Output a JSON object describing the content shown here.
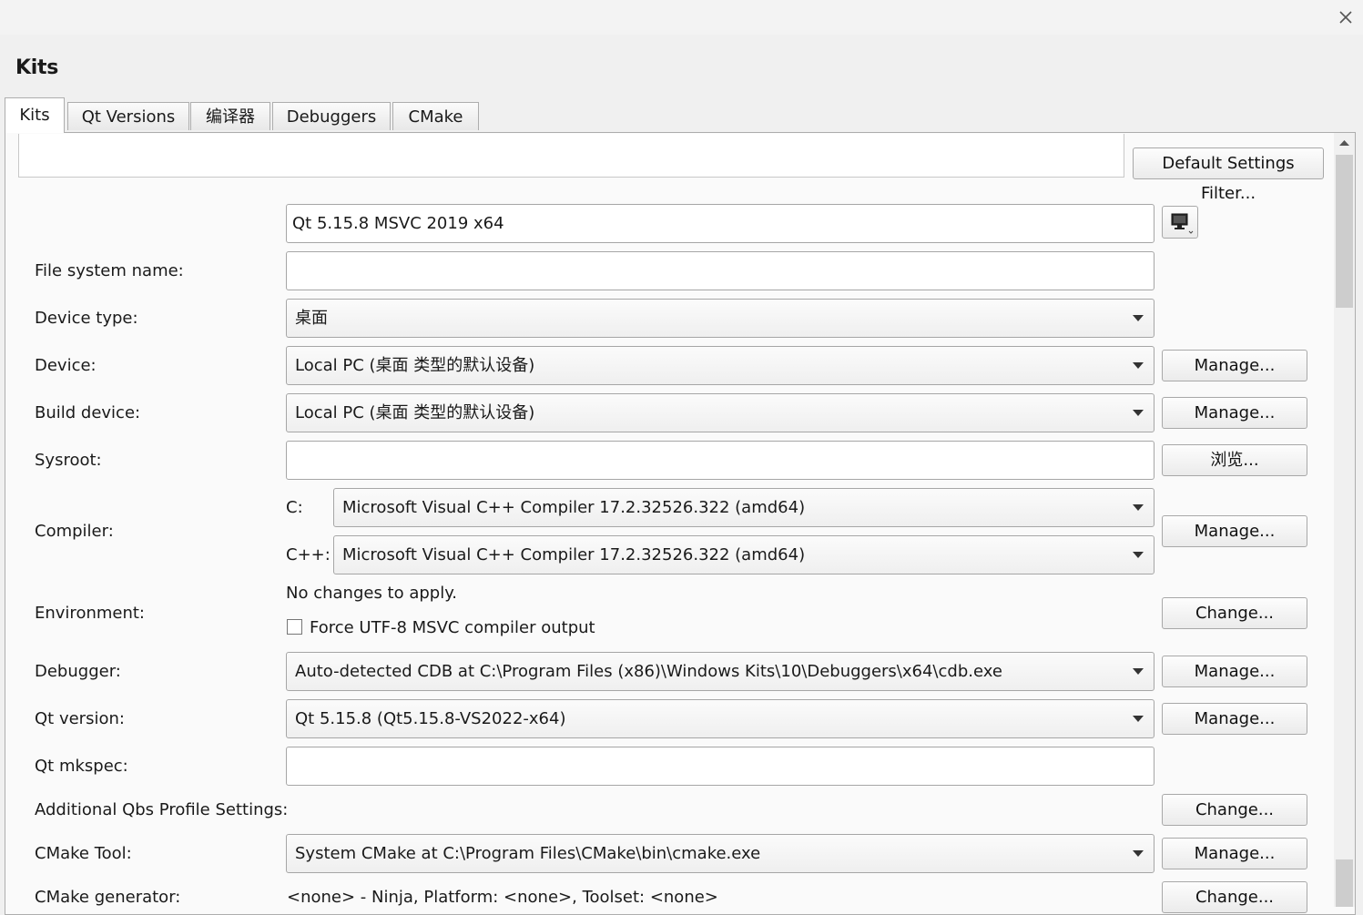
{
  "heading": "Kits",
  "tabs": [
    {
      "label": "Kits",
      "active": true
    },
    {
      "label": "Qt Versions",
      "active": false
    },
    {
      "label": "编译器",
      "active": false
    },
    {
      "label": "Debuggers",
      "active": false
    },
    {
      "label": "CMake",
      "active": false
    }
  ],
  "filter_button": "Default Settings Filter...",
  "kit_name": "Qt 5.15.8 MSVC 2019 x64",
  "icons": {
    "close": "close-icon",
    "device": "monitor-icon",
    "scroll_up": "scroll-up-arrow-icon"
  },
  "rows": {
    "fs_name": {
      "label": "File system name:",
      "value": ""
    },
    "device_type": {
      "label": "Device type:",
      "value": "桌面"
    },
    "device": {
      "label": "Device:",
      "value": "Local PC (桌面 类型的默认设备)",
      "button": "Manage..."
    },
    "build_device": {
      "label": "Build device:",
      "value": "Local PC (桌面 类型的默认设备)",
      "button": "Manage..."
    },
    "sysroot": {
      "label": "Sysroot:",
      "value": "",
      "button": "浏览..."
    },
    "compiler": {
      "label": "Compiler:",
      "c_label": "C:",
      "c_value": "Microsoft Visual C++ Compiler 17.2.32526.322 (amd64)",
      "cpp_label": "C++:",
      "cpp_value": "Microsoft Visual C++ Compiler 17.2.32526.322 (amd64)",
      "button": "Manage..."
    },
    "environment": {
      "label": "Environment:",
      "status": "No changes to apply.",
      "checkbox_label": "Force UTF-8 MSVC compiler output",
      "checkbox_checked": false,
      "button": "Change..."
    },
    "debugger": {
      "label": "Debugger:",
      "value": "Auto-detected CDB at C:\\Program Files (x86)\\Windows Kits\\10\\Debuggers\\x64\\cdb.exe",
      "button": "Manage..."
    },
    "qt_version": {
      "label": "Qt version:",
      "value": "Qt 5.15.8 (Qt5.15.8-VS2022-x64)",
      "button": "Manage..."
    },
    "qt_mkspec": {
      "label": "Qt mkspec:",
      "value": ""
    },
    "qbs": {
      "label": "Additional Qbs Profile Settings:",
      "button": "Change..."
    },
    "cmake_tool": {
      "label": "CMake Tool:",
      "value": "System CMake at C:\\Program Files\\CMake\\bin\\cmake.exe",
      "button": "Manage..."
    },
    "cmake_generator": {
      "label": "CMake generator:",
      "value": "<none> - Ninja, Platform: <none>, Toolset: <none>",
      "button": "Change..."
    }
  }
}
